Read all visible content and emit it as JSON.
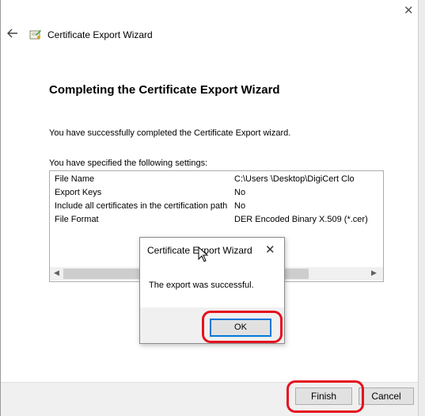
{
  "window": {
    "close_glyph": "✕",
    "title": "Certificate Export Wizard",
    "icons": [
      "back-arrow-icon",
      "certificate-icon",
      "close-icon"
    ]
  },
  "page": {
    "heading": "Completing the Certificate Export Wizard",
    "success_message": "You have successfully completed the Certificate Export wizard.",
    "settings_intro": "You have specified the following settings:",
    "settings": [
      {
        "key": "File Name",
        "value": "C:\\Users              \\Desktop\\DigiCert Clo"
      },
      {
        "key": "Export Keys",
        "value": "No"
      },
      {
        "key": "Include all certificates in the certification path",
        "value": "No"
      },
      {
        "key": "File Format",
        "value": "DER Encoded Binary X.509 (*.cer)"
      }
    ]
  },
  "dialog": {
    "title": "Certificate Export Wizard",
    "close_glyph": "✕",
    "message": "The export was successful.",
    "ok_label": "OK"
  },
  "footer": {
    "finish_label": "Finish",
    "cancel_label": "Cancel"
  },
  "colors": {
    "highlight": "#e5121f",
    "focus_border": "#0078d7",
    "button_face": "#e1e1e1"
  }
}
